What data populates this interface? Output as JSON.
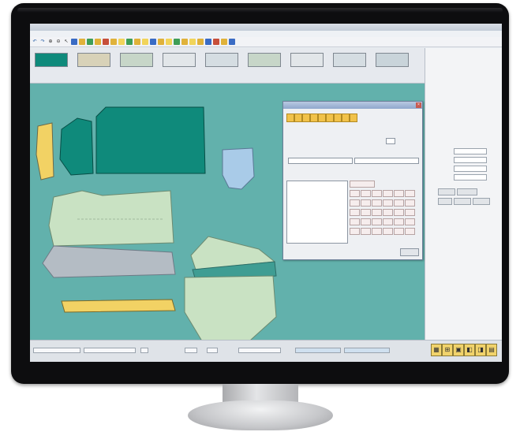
{
  "app": {
    "title": "",
    "menus": [
      "",
      "",
      "",
      "",
      "",
      "",
      "",
      "",
      "",
      "",
      ""
    ]
  },
  "toolbar": {
    "icons": [
      "undo-icon",
      "redo-icon",
      "zoom-in-icon",
      "zoom-out-icon",
      "select-icon",
      "pen-icon",
      "ruler-icon",
      "notch-icon",
      "cut-icon",
      "rotate-icon",
      "mirror-icon",
      "grade-icon",
      "seam-icon",
      "grain-icon",
      "dart-icon",
      "pleat-icon",
      "point-icon",
      "curve-icon",
      "line-icon",
      "measure-icon",
      "text-icon",
      "hide-icon",
      "print-icon",
      "save-icon",
      "open-icon",
      "help-icon"
    ]
  },
  "pieces_bar": {
    "items": [
      {
        "label": ""
      },
      {
        "label": ""
      },
      {
        "label": ""
      },
      {
        "label": ""
      },
      {
        "label": ""
      },
      {
        "label": ""
      },
      {
        "label": ""
      },
      {
        "label": ""
      },
      {
        "label": ""
      }
    ]
  },
  "dialog": {
    "title": "",
    "icons": [
      "doc-icon",
      "doc-icon",
      "doc-icon",
      "doc-icon",
      "doc-icon",
      "doc-icon",
      "doc-icon",
      "doc-icon",
      "doc-icon"
    ],
    "field1_label": "",
    "field2_label": "",
    "list_header": "",
    "ok_label": ""
  },
  "right_panel": {
    "heading": "",
    "rows": [
      "",
      "",
      "",
      ""
    ],
    "buttons": [
      "",
      "",
      "",
      "",
      ""
    ]
  },
  "status_bar": {
    "fields": [
      "",
      "",
      "",
      "",
      "",
      "",
      "",
      ""
    ],
    "icons": [
      "grid-icon",
      "measure-icon",
      "piece-icon",
      "mirror-icon",
      "fold-icon",
      "layout-icon"
    ]
  },
  "colors": {
    "workarea": "#62b1ac",
    "piece_dark": "#0f8a7b",
    "piece_light": "#c9e2c3",
    "piece_yellow": "#f2d264",
    "piece_gray": "#b4bcc4",
    "piece_blue": "#a9cbe8"
  }
}
